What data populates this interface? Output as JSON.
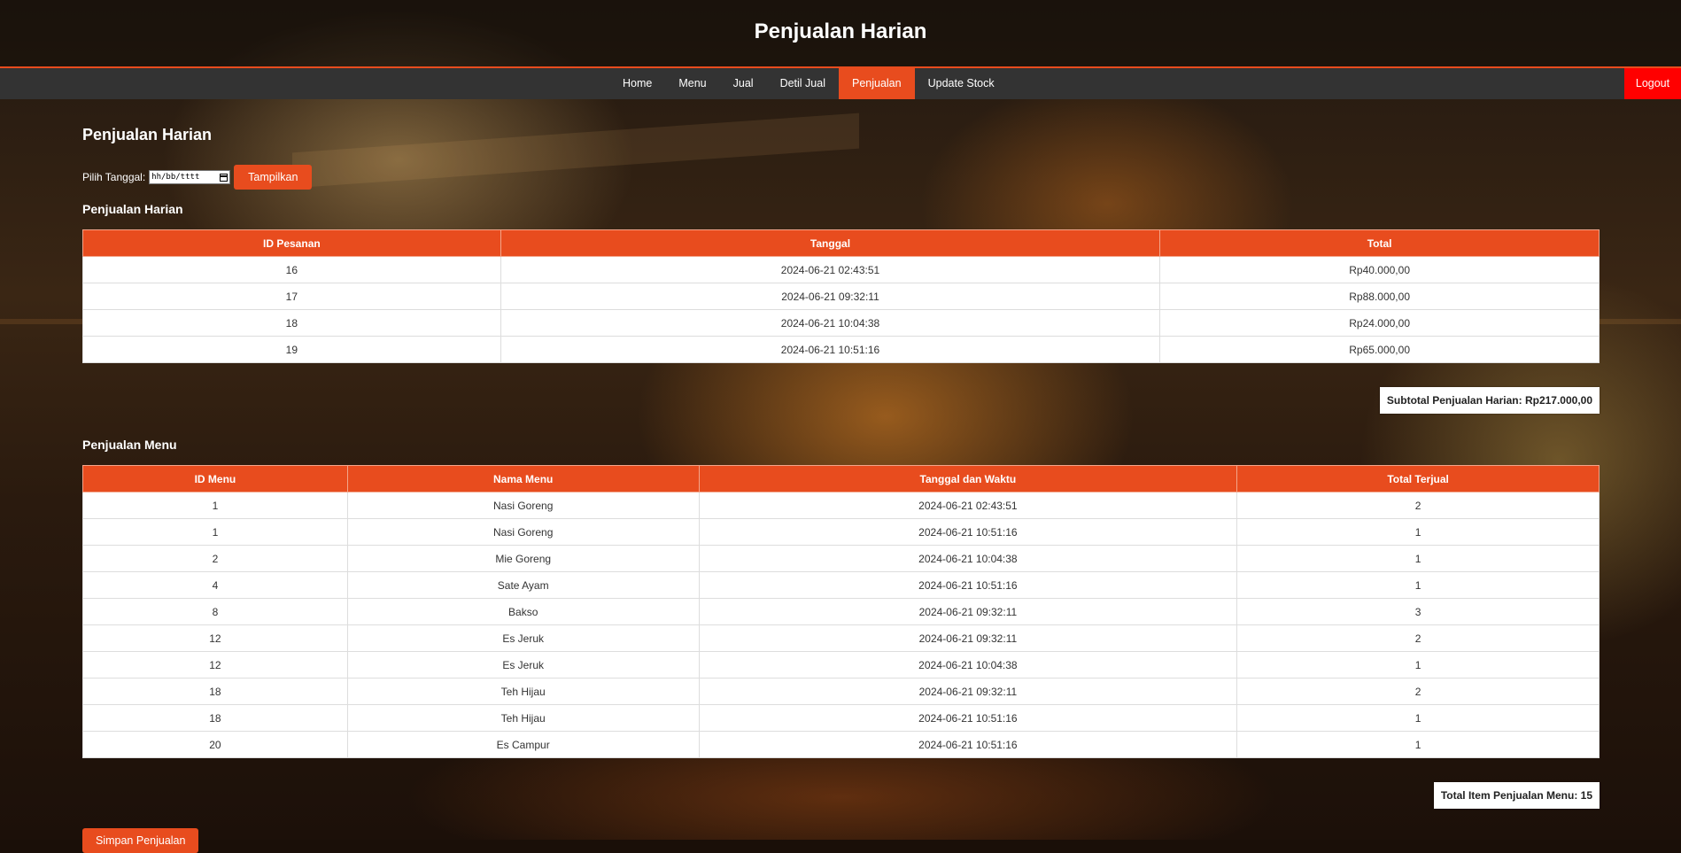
{
  "header": {
    "title": "Penjualan Harian"
  },
  "nav": {
    "items": [
      "Home",
      "Menu",
      "Jual",
      "Detil Jual",
      "Penjualan",
      "Update Stock"
    ],
    "active": "Penjualan",
    "logout": "Logout"
  },
  "page": {
    "heading": "Penjualan Harian",
    "filter_label": "Pilih Tanggal:",
    "date_placeholder": "hh/bb/tttt",
    "show_button": "Tampilkan"
  },
  "daily_sales": {
    "title": "Penjualan Harian",
    "columns": [
      "ID Pesanan",
      "Tanggal",
      "Total"
    ],
    "rows": [
      [
        "16",
        "2024-06-21 02:43:51",
        "Rp40.000,00"
      ],
      [
        "17",
        "2024-06-21 09:32:11",
        "Rp88.000,00"
      ],
      [
        "18",
        "2024-06-21 10:04:38",
        "Rp24.000,00"
      ],
      [
        "19",
        "2024-06-21 10:51:16",
        "Rp65.000,00"
      ]
    ],
    "subtotal": "Subtotal Penjualan Harian: Rp217.000,00"
  },
  "menu_sales": {
    "title": "Penjualan Menu",
    "columns": [
      "ID Menu",
      "Nama Menu",
      "Tanggal dan Waktu",
      "Total Terjual"
    ],
    "rows": [
      [
        "1",
        "Nasi Goreng",
        "2024-06-21 02:43:51",
        "2"
      ],
      [
        "1",
        "Nasi Goreng",
        "2024-06-21 10:51:16",
        "1"
      ],
      [
        "2",
        "Mie Goreng",
        "2024-06-21 10:04:38",
        "1"
      ],
      [
        "4",
        "Sate Ayam",
        "2024-06-21 10:51:16",
        "1"
      ],
      [
        "8",
        "Bakso",
        "2024-06-21 09:32:11",
        "3"
      ],
      [
        "12",
        "Es Jeruk",
        "2024-06-21 09:32:11",
        "2"
      ],
      [
        "12",
        "Es Jeruk",
        "2024-06-21 10:04:38",
        "1"
      ],
      [
        "18",
        "Teh Hijau",
        "2024-06-21 09:32:11",
        "2"
      ],
      [
        "18",
        "Teh Hijau",
        "2024-06-21 10:51:16",
        "1"
      ],
      [
        "20",
        "Es Campur",
        "2024-06-21 10:51:16",
        "1"
      ]
    ],
    "total_items": "Total Item Penjualan Menu: 15"
  },
  "save_button": "Simpan Penjualan",
  "colors": {
    "accent": "#e84c1e",
    "logout": "#ff0000",
    "nav_bg": "#333333"
  }
}
